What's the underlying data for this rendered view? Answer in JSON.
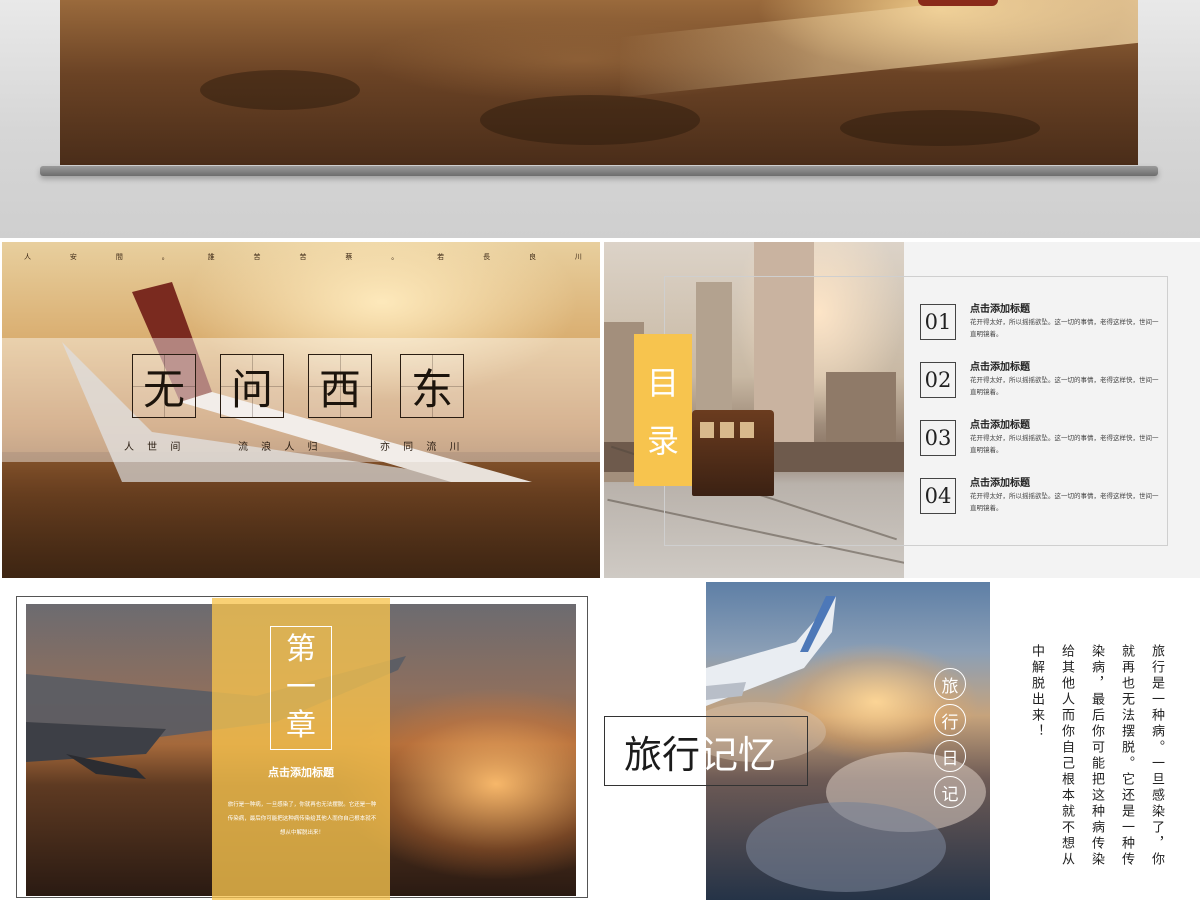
{
  "slide_title": {
    "topline": [
      "人",
      "安",
      "間",
      "。",
      "誰",
      "苦",
      "苦",
      "蔡",
      "。",
      "若",
      "長",
      "良",
      "川"
    ],
    "title_chars": [
      "无",
      "问",
      "西",
      "东"
    ],
    "subline": [
      "人 世 间",
      "流 浪 人 归",
      "亦 同 流 川"
    ]
  },
  "slide_contents": {
    "heading_chars": [
      "目",
      "录"
    ],
    "items": [
      {
        "num": "01",
        "title": "点击添加标题",
        "text": "花开得太好，所以摇摇欲坠。这一切的事情，老得这样快，世间一直明镜着。"
      },
      {
        "num": "02",
        "title": "点击添加标题",
        "text": "花开得太好，所以摇摇欲坠。这一切的事情，老得这样快，世间一直明镜着。"
      },
      {
        "num": "03",
        "title": "点击添加标题",
        "text": "花开得太好，所以摇摇欲坠。这一切的事情，老得这样快，世间一直明镜着。"
      },
      {
        "num": "04",
        "title": "点击添加标题",
        "text": "花开得太好，所以摇摇欲坠。这一切的事情，老得这样快，世间一直明镜着。"
      }
    ]
  },
  "slide_chapter": {
    "chapter_chars": [
      "第",
      "一",
      "章"
    ],
    "title": "点击添加标题",
    "body": "旅行是一种病，一旦感染了，你就再也无法摆脱。它还是一种传染病，最后你可能把这种病传染给其他人而你自己根本就不想从中解脱出来！"
  },
  "slide_memory": {
    "title_dark": "旅行",
    "title_light": "记忆",
    "circle_chars": [
      "旅",
      "行",
      "日",
      "记"
    ],
    "columns": [
      "旅行是一种病。一旦感染了，你",
      "就再也无法摆脱。它还是一种传",
      "染病，最后你可能把这种病传染",
      "给其他人而你自己根本就不想从",
      "中解脱出来！"
    ]
  },
  "colors": {
    "accent_yellow": "#f7c44e",
    "ink": "#1c140c"
  }
}
